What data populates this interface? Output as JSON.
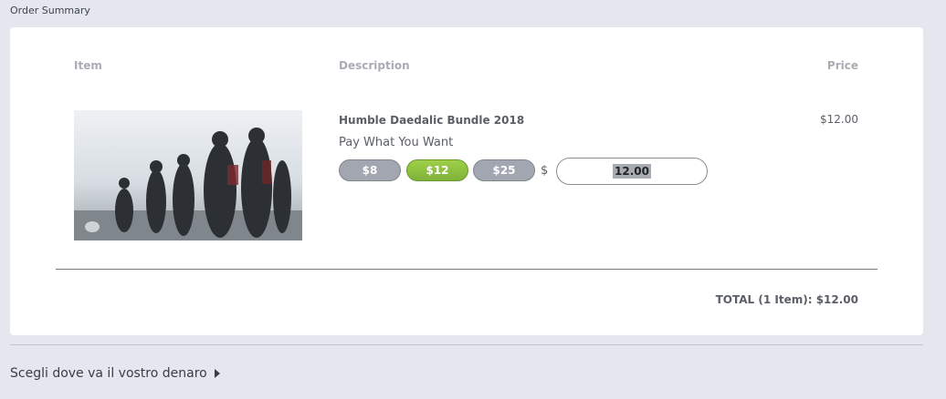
{
  "summary": {
    "title": "Order Summary"
  },
  "table": {
    "headers": {
      "item": "Item",
      "description": "Description",
      "price": "Price"
    }
  },
  "product": {
    "name": "Humble Daedalic Bundle 2018",
    "subtitle": "Pay What You Want",
    "price": "$12.00",
    "image_icon": "bundle-artwork"
  },
  "pricing": {
    "options": [
      "$8",
      "$12",
      "$25"
    ],
    "selected": "$12",
    "currency_symbol": "$",
    "amount_value": "12.00"
  },
  "totals": {
    "total_label": "TOTAL (1 Item): $12.00"
  },
  "expander": {
    "label": "Scegli dove va il vostro denaro"
  },
  "colors": {
    "page_bg": "#e4e7ee",
    "card_bg": "#ffffff",
    "button_gray": "#a1a6b1",
    "button_active": "#8bc043"
  }
}
